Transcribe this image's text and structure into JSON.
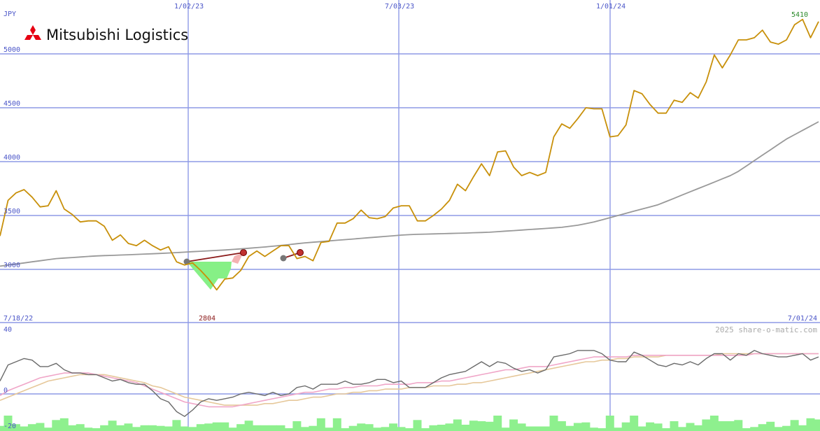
{
  "chart_data": [
    {
      "type": "line",
      "title": "Mitsubishi Logistics",
      "currency": "JPY",
      "ylim": [
        2450,
        5600
      ],
      "y_ticks": [
        3000,
        3500,
        4000,
        4500,
        5000
      ],
      "grid": true,
      "date_labels": [
        "7/18/22",
        "1/02/23",
        "7/03/23",
        "1/01/24",
        "7/01/24"
      ],
      "x": [
        "2022-07-18",
        "2022-07-25",
        "2022-08-01",
        "2022-08-08",
        "2022-08-15",
        "2022-08-22",
        "2022-08-29",
        "2022-09-05",
        "2022-09-12",
        "2022-09-19",
        "2022-09-26",
        "2022-10-03",
        "2022-10-10",
        "2022-10-17",
        "2022-10-24",
        "2022-10-31",
        "2022-11-07",
        "2022-11-14",
        "2022-11-21",
        "2022-11-28",
        "2022-12-05",
        "2022-12-12",
        "2022-12-19",
        "2022-12-26",
        "2023-01-02",
        "2023-01-09",
        "2023-01-16",
        "2023-01-23",
        "2023-01-30",
        "2023-02-06",
        "2023-02-13",
        "2023-02-20",
        "2023-02-27",
        "2023-03-06",
        "2023-03-13",
        "2023-03-20",
        "2023-03-27",
        "2023-04-03",
        "2023-04-10",
        "2023-04-17",
        "2023-04-24",
        "2023-05-01",
        "2023-05-08",
        "2023-05-15",
        "2023-05-22",
        "2023-05-29",
        "2023-06-05",
        "2023-06-12",
        "2023-06-19",
        "2023-06-26",
        "2023-07-03",
        "2023-07-10",
        "2023-07-17",
        "2023-07-24",
        "2023-07-31",
        "2023-08-07",
        "2023-08-14",
        "2023-08-21",
        "2023-08-28",
        "2023-09-04",
        "2023-09-11",
        "2023-09-18",
        "2023-09-25",
        "2023-10-02",
        "2023-10-09",
        "2023-10-16",
        "2023-10-23",
        "2023-10-30",
        "2023-11-06",
        "2023-11-13",
        "2023-11-20",
        "2023-11-27",
        "2023-12-04",
        "2023-12-11",
        "2023-12-18",
        "2023-12-25",
        "2024-01-01",
        "2024-01-08",
        "2024-01-15",
        "2024-01-22",
        "2024-01-29",
        "2024-02-05",
        "2024-02-12",
        "2024-02-19",
        "2024-02-26",
        "2024-03-04",
        "2024-03-11",
        "2024-03-18",
        "2024-03-25",
        "2024-04-01",
        "2024-04-08",
        "2024-04-15",
        "2024-04-22",
        "2024-04-29",
        "2024-05-06",
        "2024-05-13",
        "2024-05-20",
        "2024-05-27",
        "2024-06-03",
        "2024-06-10",
        "2024-06-17",
        "2024-06-24",
        "2024-07-01"
      ],
      "series": [
        {
          "values": [
            3310,
            3640,
            3710,
            3740,
            3670,
            3580,
            3590,
            3730,
            3560,
            3510,
            3440,
            3450,
            3450,
            3400,
            3270,
            3320,
            3240,
            3220,
            3270,
            3220,
            3180,
            3210,
            3070,
            3040,
            3060,
            2990,
            2910,
            2810,
            2910,
            2920,
            2990,
            3120,
            3170,
            3120,
            3170,
            3220,
            3220,
            3100,
            3120,
            3080,
            3250,
            3260,
            3430,
            3430,
            3470,
            3550,
            3480,
            3470,
            3490,
            3570,
            3590,
            3590,
            3450,
            3450,
            3500,
            3560,
            3640,
            3790,
            3730,
            3860,
            3980,
            3870,
            4090,
            4100,
            3950,
            3870,
            3900,
            3870,
            3900,
            4230,
            4350,
            4310,
            4400,
            4500,
            4490,
            4490,
            4230,
            4240,
            4340,
            4660,
            4630,
            4530,
            4450,
            4450,
            4570,
            4550,
            4640,
            4590,
            4740,
            4990,
            4870,
            4990,
            5130,
            5130,
            5150,
            5220,
            5110,
            5090,
            5130,
            5270,
            5320,
            5150,
            5300
          ]
        },
        {
          "values": [
            3030,
            3040,
            3050,
            3060,
            3070,
            3080,
            3090,
            3100,
            3105,
            3110,
            3115,
            3120,
            3125,
            3128,
            3130,
            3133,
            3136,
            3139,
            3142,
            3145,
            3148,
            3152,
            3156,
            3160,
            3164,
            3168,
            3172,
            3176,
            3180,
            3185,
            3190,
            3196,
            3202,
            3208,
            3215,
            3222,
            3230,
            3238,
            3246,
            3252,
            3258,
            3264,
            3270,
            3276,
            3282,
            3288,
            3294,
            3300,
            3306,
            3312,
            3318,
            3322,
            3325,
            3327,
            3329,
            3331,
            3333,
            3335,
            3337,
            3340,
            3342,
            3345,
            3350,
            3355,
            3360,
            3365,
            3370,
            3375,
            3380,
            3385,
            3390,
            3400,
            3410,
            3425,
            3440,
            3460,
            3480,
            3500,
            3520,
            3540,
            3560,
            3580,
            3600,
            3630,
            3660,
            3690,
            3720,
            3750,
            3780,
            3810,
            3840,
            3870,
            3910,
            3960,
            4010,
            4060,
            4110,
            4160,
            4210,
            4250,
            4290,
            4330,
            4370
          ]
        }
      ],
      "annotations": [
        {
          "text": "2804",
          "x": "2023-01-23",
          "y": 2804
        },
        {
          "text": "5410",
          "x": "2024-06-24",
          "y": 5410
        }
      ]
    },
    {
      "type": "line",
      "ylim": [
        -20,
        40
      ],
      "y_ticks": [
        40,
        0,
        -20
      ],
      "series": [
        {
          "values": [
            8,
            18,
            20,
            22,
            21,
            17,
            17,
            19,
            15,
            13,
            13,
            12,
            12,
            10,
            8,
            9,
            7,
            6,
            6,
            2,
            -3,
            -5,
            -11,
            -14,
            -10,
            -5,
            -3,
            -4,
            -3,
            -2,
            0,
            1,
            0,
            -1,
            1,
            -1,
            0,
            4,
            5,
            3,
            6,
            6,
            6,
            8,
            6,
            6,
            7,
            9,
            9,
            7,
            8,
            4,
            4,
            4,
            7,
            10,
            12,
            13,
            14,
            17,
            20,
            17,
            20,
            19,
            16,
            14,
            15,
            13,
            15,
            23,
            24,
            25,
            27,
            27,
            27,
            25,
            21,
            20,
            20,
            26,
            24,
            21,
            18,
            17,
            19,
            18,
            20,
            18,
            22,
            25,
            25,
            21,
            25,
            24,
            27,
            25,
            24,
            23,
            23,
            24,
            25,
            21,
            23
          ]
        },
        {
          "values": [
            -1,
            2,
            4,
            6,
            8,
            10,
            11,
            12,
            13,
            13,
            13,
            13,
            12,
            11,
            10,
            9,
            8,
            7,
            5,
            3,
            1,
            -1,
            -3,
            -5,
            -6,
            -7,
            -8,
            -8,
            -8,
            -8,
            -7,
            -6,
            -5,
            -4,
            -3,
            -2,
            -1,
            0,
            1,
            1,
            2,
            3,
            3,
            4,
            4,
            5,
            5,
            5,
            6,
            6,
            6,
            6,
            7,
            7,
            7,
            8,
            8,
            9,
            10,
            11,
            12,
            13,
            14,
            15,
            15,
            16,
            17,
            17,
            17,
            18,
            19,
            20,
            21,
            22,
            23,
            23,
            23,
            23,
            23,
            24,
            24,
            24,
            24,
            24,
            24,
            24,
            24,
            24,
            24,
            24,
            24,
            24,
            24,
            24,
            25,
            25,
            25,
            25,
            25,
            25,
            25,
            25,
            25,
            25,
            25
          ]
        },
        {
          "values": [
            -4,
            -2,
            0,
            2,
            4,
            6,
            8,
            9,
            10,
            11,
            12,
            12,
            12,
            12,
            11,
            10,
            9,
            8,
            7,
            5,
            4,
            2,
            0,
            -2,
            -3,
            -4,
            -5,
            -6,
            -7,
            -7,
            -7,
            -7,
            -7,
            -6,
            -6,
            -5,
            -4,
            -4,
            -3,
            -2,
            -2,
            -1,
            0,
            0,
            1,
            1,
            2,
            2,
            3,
            3,
            3,
            4,
            4,
            4,
            5,
            5,
            5,
            6,
            6,
            7,
            7,
            8,
            9,
            10,
            11,
            12,
            13,
            14,
            15,
            16,
            17,
            18,
            19,
            20,
            20,
            21,
            21,
            22,
            22,
            23,
            23,
            23,
            23,
            24,
            24,
            24,
            24,
            24,
            24,
            24,
            25,
            25,
            25,
            25,
            25,
            25,
            25,
            25,
            25,
            25,
            25,
            25,
            25
          ]
        }
      ]
    }
  ],
  "labels": {
    "currency": "JPY",
    "company": "Mitsubishi Logistics",
    "credit": "2025 share-o-matic.com",
    "low_label": "2804",
    "high_label": "5410",
    "date_top": [
      "1/02/23",
      "7/03/23",
      "1/01/24"
    ],
    "date_bottom_left": "7/18/22",
    "date_bottom_right": "7/01/24",
    "y_ticks": [
      "5000",
      "4500",
      "4000",
      "3500",
      "3000"
    ],
    "osc_ticks": [
      "40",
      "0",
      "-20"
    ]
  },
  "colors": {
    "price": "#c8900a",
    "moving_average": "#999999",
    "grid": "#8e9ae6",
    "axis_text": "#4a55c8",
    "osc_main": "#6a6a6a",
    "osc_pink": "#f0a6c8",
    "osc_tan": "#e6c89a",
    "volume": "#8ef08e",
    "low_label": "#8b1a1a",
    "high_label": "#2a8a2a",
    "credit": "#aaaaaa",
    "logo_red": "#e60012"
  }
}
